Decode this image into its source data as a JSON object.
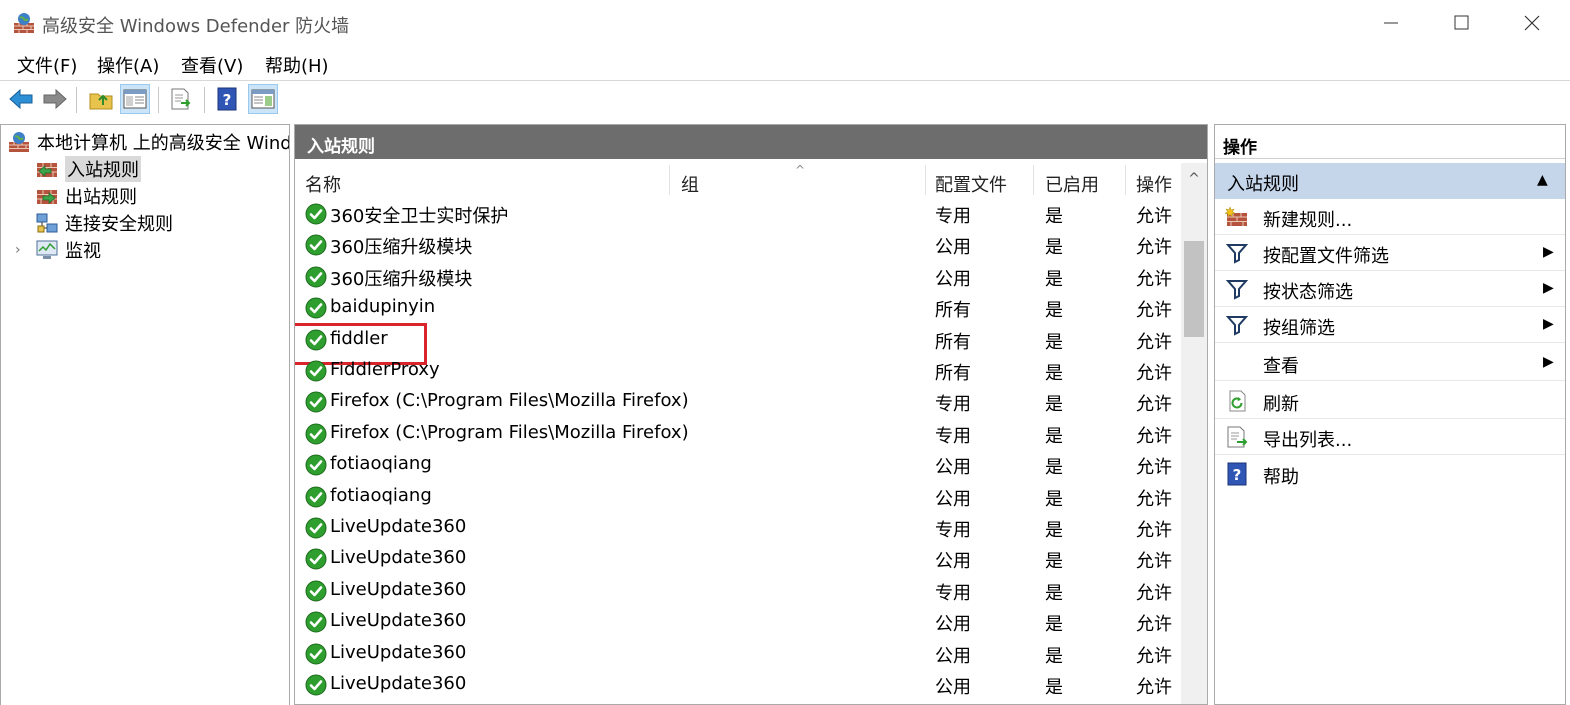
{
  "window": {
    "title": "高级安全 Windows Defender 防火墙"
  },
  "menu": [
    "文件(F)",
    "操作(A)",
    "查看(V)",
    "帮助(H)"
  ],
  "toolbar": {
    "icons": [
      "back-arrow-icon",
      "forward-arrow-icon",
      "folder-up-icon",
      "show-hide-console-tree-icon",
      "export-list-icon",
      "help-icon",
      "show-hide-action-pane-icon"
    ]
  },
  "tree": {
    "root": "本地计算机 上的高级安全 Windows Defender 防火墙",
    "items": [
      {
        "label": "入站规则",
        "selected": true
      },
      {
        "label": "出站规则"
      },
      {
        "label": "连接安全规则"
      },
      {
        "label": "监视",
        "expandable": true
      }
    ]
  },
  "center": {
    "header": "入站规则",
    "columns": [
      "名称",
      "组",
      "配置文件",
      "已启用",
      "操作"
    ],
    "rows": [
      {
        "name": "360安全卫士实时保护",
        "profile": "专用",
        "enabled": "是",
        "action": "允许"
      },
      {
        "name": "360压缩升级模块",
        "profile": "公用",
        "enabled": "是",
        "action": "允许"
      },
      {
        "name": "360压缩升级模块",
        "profile": "公用",
        "enabled": "是",
        "action": "允许"
      },
      {
        "name": "baidupinyin",
        "profile": "所有",
        "enabled": "是",
        "action": "允许"
      },
      {
        "name": "fiddler",
        "profile": "所有",
        "enabled": "是",
        "action": "允许",
        "highlighted": true
      },
      {
        "name": "FiddlerProxy",
        "profile": "所有",
        "enabled": "是",
        "action": "允许"
      },
      {
        "name": "Firefox (C:\\Program Files\\Mozilla Firefox)",
        "profile": "专用",
        "enabled": "是",
        "action": "允许"
      },
      {
        "name": "Firefox (C:\\Program Files\\Mozilla Firefox)",
        "profile": "专用",
        "enabled": "是",
        "action": "允许"
      },
      {
        "name": "fotiaoqiang",
        "profile": "公用",
        "enabled": "是",
        "action": "允许"
      },
      {
        "name": "fotiaoqiang",
        "profile": "公用",
        "enabled": "是",
        "action": "允许"
      },
      {
        "name": "LiveUpdate360",
        "profile": "专用",
        "enabled": "是",
        "action": "允许"
      },
      {
        "name": "LiveUpdate360",
        "profile": "公用",
        "enabled": "是",
        "action": "允许"
      },
      {
        "name": "LiveUpdate360",
        "profile": "专用",
        "enabled": "是",
        "action": "允许"
      },
      {
        "name": "LiveUpdate360",
        "profile": "公用",
        "enabled": "是",
        "action": "允许"
      },
      {
        "name": "LiveUpdate360",
        "profile": "公用",
        "enabled": "是",
        "action": "允许"
      },
      {
        "name": "LiveUpdate360",
        "profile": "公用",
        "enabled": "是",
        "action": "允许"
      }
    ]
  },
  "actions": {
    "header": "操作",
    "section": "入站规则",
    "items": [
      {
        "label": "新建规则...",
        "icon": "new-rule-icon"
      },
      {
        "label": "按配置文件筛选",
        "icon": "filter-icon",
        "submenu": true
      },
      {
        "label": "按状态筛选",
        "icon": "filter-icon",
        "submenu": true
      },
      {
        "label": "按组筛选",
        "icon": "filter-icon",
        "submenu": true
      },
      {
        "label": "查看",
        "icon": "",
        "submenu": true
      },
      {
        "label": "刷新",
        "icon": "refresh-icon"
      },
      {
        "label": "导出列表...",
        "icon": "export-list-icon"
      },
      {
        "label": "帮助",
        "icon": "help-icon"
      }
    ]
  },
  "colors": {
    "highlight_box": "#d9242b",
    "center_header_bg": "#6d6d6d",
    "action_section_bg": "#c5d5ea",
    "check_green": "#2e9e2e"
  }
}
